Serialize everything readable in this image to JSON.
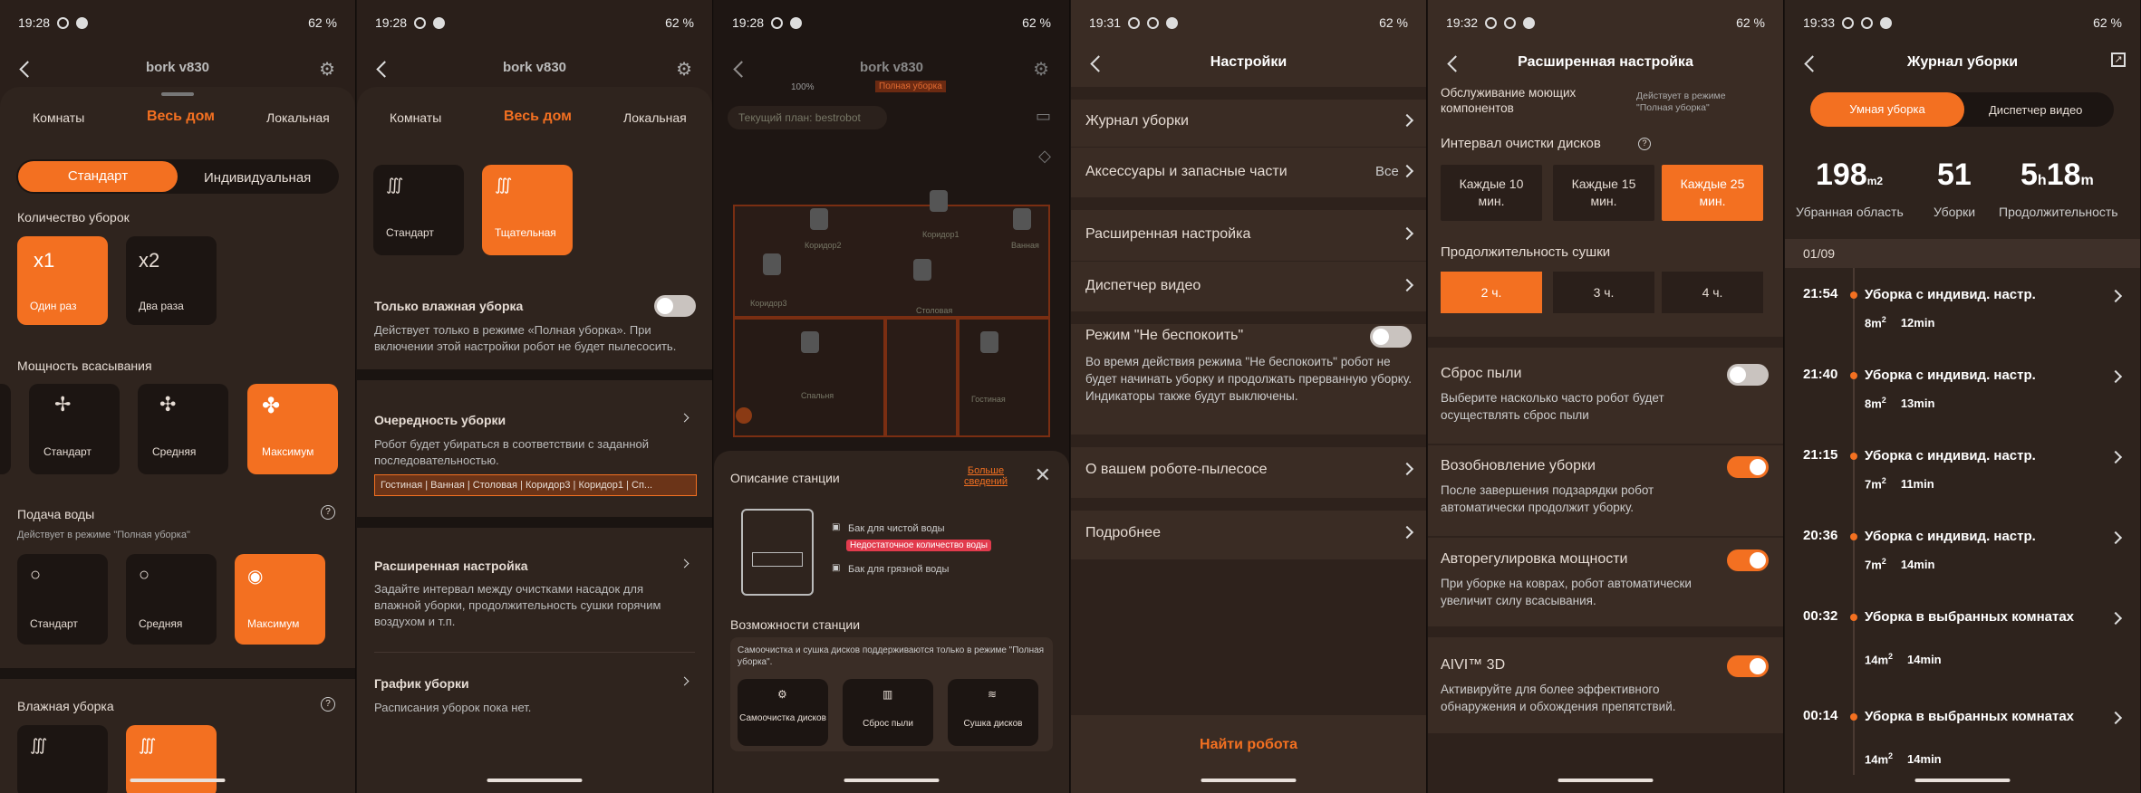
{
  "status": {
    "t1": "19:28",
    "t2": "19:28",
    "t3": "19:28",
    "t4": "19:31",
    "t5": "19:32",
    "t6": "19:33",
    "battery": "62 %"
  },
  "p1": {
    "title": "bork v830",
    "tabs": [
      "Комнаты",
      "Весь дом",
      "Локальная"
    ],
    "modes": [
      "Стандарт",
      "Индивидуальная"
    ],
    "count_label": "Количество уборок",
    "count": [
      {
        "x": "x1",
        "label": "Один раз"
      },
      {
        "x": "x2",
        "label": "Два раза"
      }
    ],
    "power_label": "Мощность всасывания",
    "power": [
      "Стандарт",
      "Средняя",
      "Максимум"
    ],
    "water_label": "Подача воды",
    "water_note": "Действует в режиме \"Полная уборка\"",
    "water": [
      "Стандарт",
      "Средняя",
      "Максимум"
    ],
    "wet_label": "Влажная уборка"
  },
  "p2": {
    "title": "bork v830",
    "tabs": [
      "Комнаты",
      "Весь дом",
      "Локальная"
    ],
    "wetmodes": [
      "Стандарт",
      "Тщательная"
    ],
    "only_wet": "Только влажная уборка",
    "only_wet_desc": "Действует только в режиме «Полная уборка». При включении этой настройки робот не будет пылесосить.",
    "order_title": "Очередность уборки",
    "order_desc": "Робот будет убираться в соответствии с заданной последовательностью.",
    "order_seq": "Гостиная | Ванная | Столовая | Коридор3 | Коридор1 | Сп...",
    "adv_title": "Расширенная настройка",
    "adv_desc": "Задайте интервал между очистками насадок для влажной уборки, продолжительность сушки горячим воздухом и т.п.",
    "sched_title": "График уборки",
    "sched_desc": "Расписания уборок пока нет."
  },
  "p3": {
    "title": "bork v830",
    "badge1": "100%",
    "badge2": "Полная уборка",
    "plan": "Текущий план: bestrobot",
    "rooms": [
      "Коридор2",
      "Коридор1",
      "Ванная",
      "Коридор3",
      "Столовая",
      "Спальня",
      "Гостиная"
    ],
    "station_title": "Описание станции",
    "more": "Больше сведений",
    "clean_tank": "Бак для чистой воды",
    "warn": "Недостаточное количество воды",
    "dirty_tank": "Бак для грязной воды",
    "features_title": "Возможности станции",
    "features_note": "Самоочистка и сушка дисков поддерживаются только в режиме \"Полная уборка\".",
    "features": [
      "Самоочистка дисков",
      "Сброс пыли",
      "Сушка дисков"
    ]
  },
  "p4": {
    "title": "Настройки",
    "items": [
      "Журнал уборки",
      "Аксессуары и запасные части",
      "Расширенная настройка",
      "Диспетчер видео"
    ],
    "all": "Все",
    "dnd_title": "Режим \"Не беспокоить\"",
    "dnd_desc": "Во время действия режима \"Не беспокоить\" робот не будет начинать уборку и продолжать прерванную уборку.  Индикаторы также будут выключены.",
    "about": "О вашем роботе-пылесосе",
    "more": "Подробнее",
    "find": "Найти робота"
  },
  "p5": {
    "title": "Расширенная настройка",
    "svc_title": "Обслуживание моющих компонентов",
    "svc_note": "Действует в режиме \"Полная уборка\"",
    "interval_label": "Интервал очистки дисков",
    "intervals": [
      "Каждые 10 мин.",
      "Каждые 15 мин.",
      "Каждые 25 мин."
    ],
    "dry_label": "Продолжительность сушки",
    "dry": [
      "2 ч.",
      "3 ч.",
      "4 ч."
    ],
    "dust_title": "Сброс пыли",
    "dust_desc": "Выберите насколько часто робот будет осуществлять сброс пыли",
    "resume_title": "Возобновление уборки",
    "resume_desc": "После завершения подзарядки робот автоматически продолжит уборку.",
    "auto_title": "Авторегулировка мощности",
    "auto_desc": "При уборке на коврах, робот автоматически увеличит силу всасывания.",
    "aivi_title": "AIVI™ 3D",
    "aivi_desc": "Активируйте для более эффективного обнаружения и обхождения препятствий."
  },
  "p6": {
    "title": "Журнал уборки",
    "tabs": [
      "Умная уборка",
      "Диспетчер видео"
    ],
    "area": "198",
    "area_unit": "m2",
    "area_label": "Убранная область",
    "count": "51",
    "count_label": "Уборки",
    "dur_h": "5",
    "dur_m": "18",
    "dur_hu": "h",
    "dur_mu": "m",
    "dur_label": "Продолжительность",
    "date": "01/09",
    "entries": [
      {
        "time": "21:54",
        "title": "Уборка с индивид. настр.",
        "area": "8m",
        "time2": "12min"
      },
      {
        "time": "21:40",
        "title": "Уборка с индивид. настр.",
        "area": "8m",
        "time2": "13min"
      },
      {
        "time": "21:15",
        "title": "Уборка с индивид. настр.",
        "area": "7m",
        "time2": "11min"
      },
      {
        "time": "20:36",
        "title": "Уборка с индивид. настр.",
        "area": "7m",
        "time2": "14min"
      },
      {
        "time": "00:32",
        "title": "Уборка в выбранных комнатах",
        "area": "14m",
        "time2": "14min"
      },
      {
        "time": "00:14",
        "title": "Уборка в выбранных комнатах",
        "area": "14m",
        "time2": "14min"
      }
    ],
    "sup": "2"
  }
}
